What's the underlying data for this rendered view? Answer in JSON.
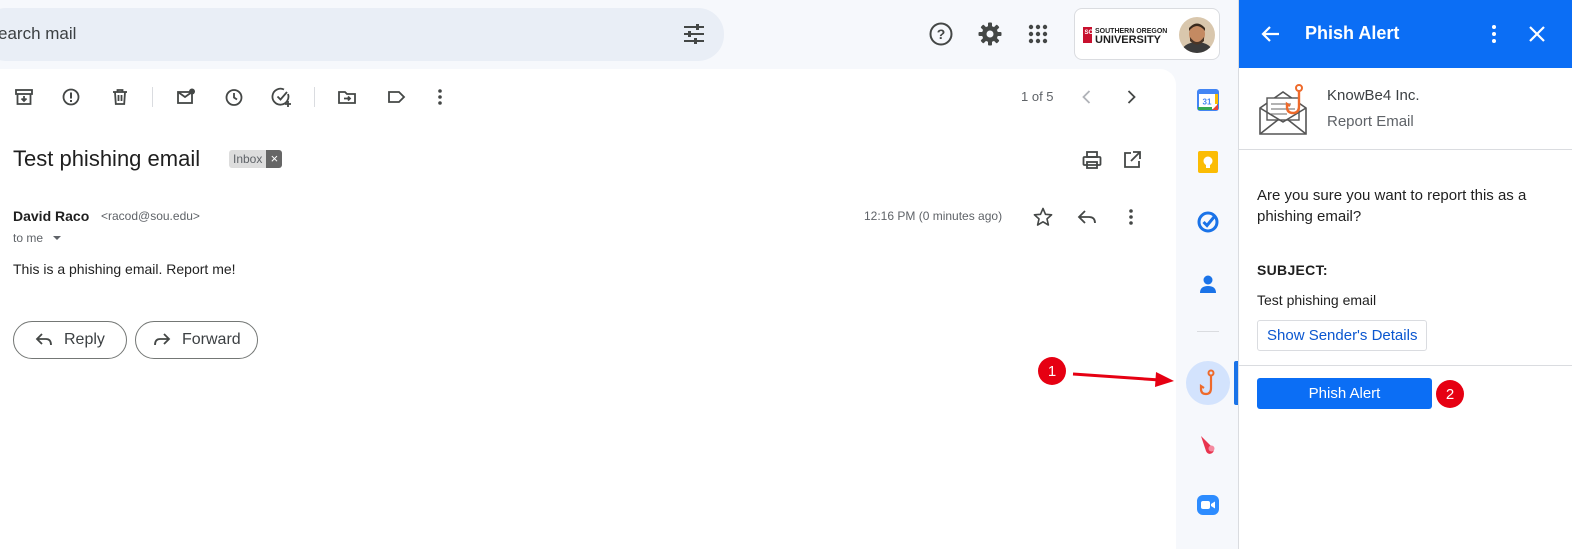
{
  "search": {
    "text": "earch mail"
  },
  "account": {
    "org_logo": "SOUTHERN OREGON UNIVERSITY"
  },
  "toolbar": {
    "pager": "1 of 5"
  },
  "message": {
    "subject": "Test phishing email",
    "label_chip": "Inbox",
    "label_chip_close": "×",
    "sender_name": "David Raco",
    "sender_email": "<racod@sou.edu>",
    "recipient": "to me",
    "timestamp": "12:16 PM (0 minutes ago)",
    "body": "This is a phishing email. Report me!",
    "reply_label": "Reply",
    "forward_label": "Forward"
  },
  "rail": {
    "calendar_day": "31"
  },
  "annotations": {
    "badge_1": "1",
    "badge_2": "2"
  },
  "panel": {
    "title": "Phish Alert",
    "vendor": "KnowBe4 Inc.",
    "subtitle": "Report Email",
    "confirm": "Are you sure you want to report this as a phishing email?",
    "subject_label": "SUBJECT:",
    "subject_value": "Test phishing email",
    "details_button": "Show Sender's Details",
    "action_button": "Phish Alert"
  },
  "colors": {
    "panel_header": "#0b6ef5",
    "badge": "#e60012",
    "hook": "#ee6a2b",
    "rail_active": "#1a73e8"
  }
}
